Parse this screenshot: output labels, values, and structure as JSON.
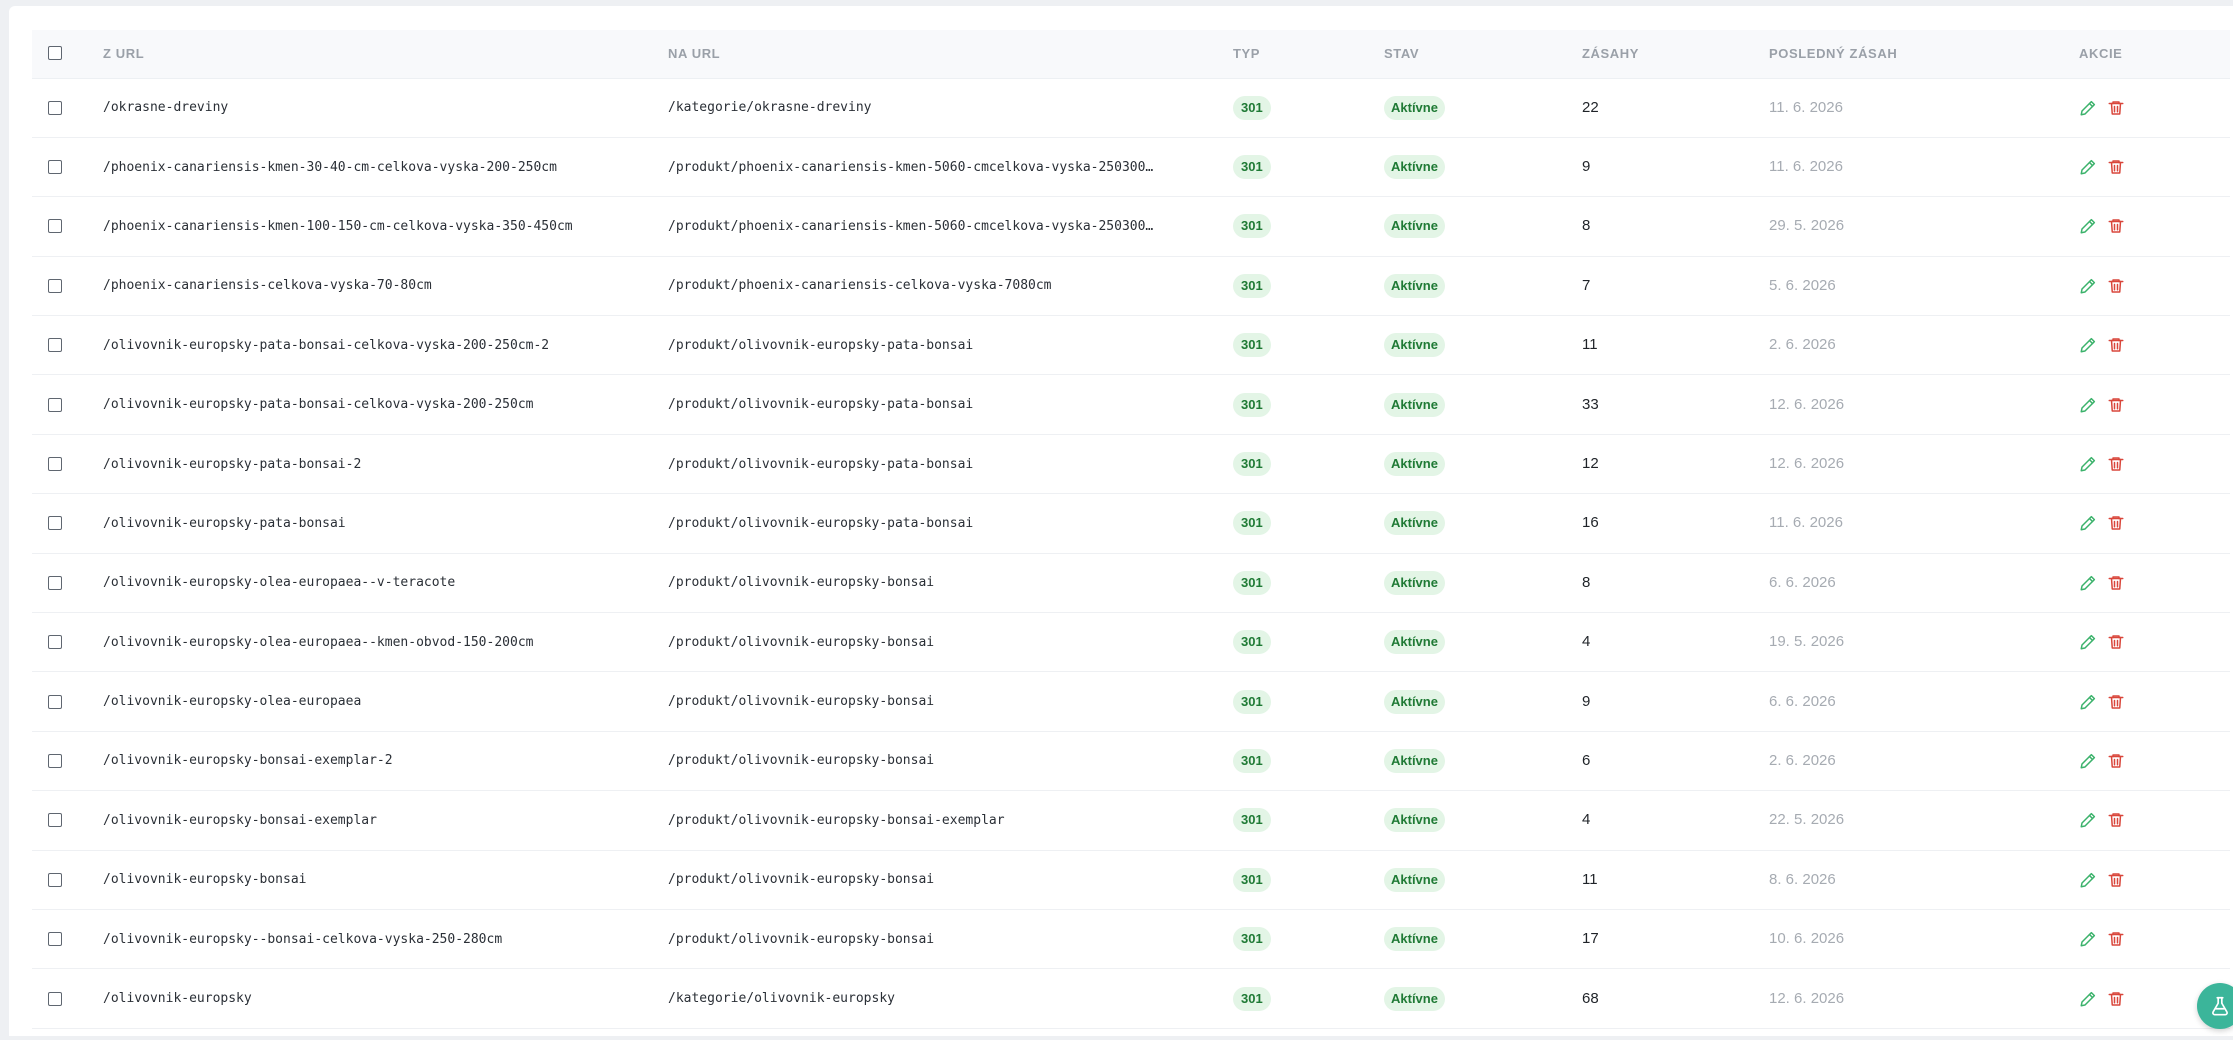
{
  "table": {
    "headers": {
      "from": "Z URL",
      "to": "NA URL",
      "type": "TYP",
      "status": "STAV",
      "hits": "ZÁSAHY",
      "last_hit": "POSLEDNÝ ZÁSAH",
      "actions": "AKCIE"
    },
    "rows": [
      {
        "from": "/okrasne-dreviny",
        "to": "/kategorie/okrasne-dreviny",
        "type": "301",
        "status": "Aktívne",
        "hits": "22",
        "last_hit": "11. 6. 2026"
      },
      {
        "from": "/phoenix-canariensis-kmen-30-40-cm-celkova-vyska-200-250cm",
        "to": "/produkt/phoenix-canariensis-kmen-5060-cmcelkova-vyska-250300…",
        "type": "301",
        "status": "Aktívne",
        "hits": "9",
        "last_hit": "11. 6. 2026"
      },
      {
        "from": "/phoenix-canariensis-kmen-100-150-cm-celkova-vyska-350-450cm",
        "to": "/produkt/phoenix-canariensis-kmen-5060-cmcelkova-vyska-250300…",
        "type": "301",
        "status": "Aktívne",
        "hits": "8",
        "last_hit": "29. 5. 2026"
      },
      {
        "from": "/phoenix-canariensis-celkova-vyska-70-80cm",
        "to": "/produkt/phoenix-canariensis-celkova-vyska-7080cm",
        "type": "301",
        "status": "Aktívne",
        "hits": "7",
        "last_hit": "5. 6. 2026"
      },
      {
        "from": "/olivovnik-europsky-pata-bonsai-celkova-vyska-200-250cm-2",
        "to": "/produkt/olivovnik-europsky-pata-bonsai",
        "type": "301",
        "status": "Aktívne",
        "hits": "11",
        "last_hit": "2. 6. 2026"
      },
      {
        "from": "/olivovnik-europsky-pata-bonsai-celkova-vyska-200-250cm",
        "to": "/produkt/olivovnik-europsky-pata-bonsai",
        "type": "301",
        "status": "Aktívne",
        "hits": "33",
        "last_hit": "12. 6. 2026"
      },
      {
        "from": "/olivovnik-europsky-pata-bonsai-2",
        "to": "/produkt/olivovnik-europsky-pata-bonsai",
        "type": "301",
        "status": "Aktívne",
        "hits": "12",
        "last_hit": "12. 6. 2026"
      },
      {
        "from": "/olivovnik-europsky-pata-bonsai",
        "to": "/produkt/olivovnik-europsky-pata-bonsai",
        "type": "301",
        "status": "Aktívne",
        "hits": "16",
        "last_hit": "11. 6. 2026"
      },
      {
        "from": "/olivovnik-europsky-olea-europaea--v-teracote",
        "to": "/produkt/olivovnik-europsky-bonsai",
        "type": "301",
        "status": "Aktívne",
        "hits": "8",
        "last_hit": "6. 6. 2026"
      },
      {
        "from": "/olivovnik-europsky-olea-europaea--kmen-obvod-150-200cm",
        "to": "/produkt/olivovnik-europsky-bonsai",
        "type": "301",
        "status": "Aktívne",
        "hits": "4",
        "last_hit": "19. 5. 2026"
      },
      {
        "from": "/olivovnik-europsky-olea-europaea",
        "to": "/produkt/olivovnik-europsky-bonsai",
        "type": "301",
        "status": "Aktívne",
        "hits": "9",
        "last_hit": "6. 6. 2026"
      },
      {
        "from": "/olivovnik-europsky-bonsai-exemplar-2",
        "to": "/produkt/olivovnik-europsky-bonsai",
        "type": "301",
        "status": "Aktívne",
        "hits": "6",
        "last_hit": "2. 6. 2026"
      },
      {
        "from": "/olivovnik-europsky-bonsai-exemplar",
        "to": "/produkt/olivovnik-europsky-bonsai-exemplar",
        "type": "301",
        "status": "Aktívne",
        "hits": "4",
        "last_hit": "22. 5. 2026"
      },
      {
        "from": "/olivovnik-europsky-bonsai",
        "to": "/produkt/olivovnik-europsky-bonsai",
        "type": "301",
        "status": "Aktívne",
        "hits": "11",
        "last_hit": "8. 6. 2026"
      },
      {
        "from": "/olivovnik-europsky--bonsai-celkova-vyska-250-280cm",
        "to": "/produkt/olivovnik-europsky-bonsai",
        "type": "301",
        "status": "Aktívne",
        "hits": "17",
        "last_hit": "10. 6. 2026"
      },
      {
        "from": "/olivovnik-europsky",
        "to": "/kategorie/olivovnik-europsky",
        "type": "301",
        "status": "Aktívne",
        "hits": "68",
        "last_hit": "12. 6. 2026"
      }
    ]
  },
  "icons": {
    "edit": "pencil-icon",
    "delete": "trash-icon",
    "fab": "flask-icon"
  },
  "colors": {
    "edit_icon": "#3bb26b",
    "delete_icon": "#d9463b",
    "badge_bg": "#e3f5e6",
    "badge_text": "#1f7a35",
    "fab_bg": "#3bb59a"
  }
}
